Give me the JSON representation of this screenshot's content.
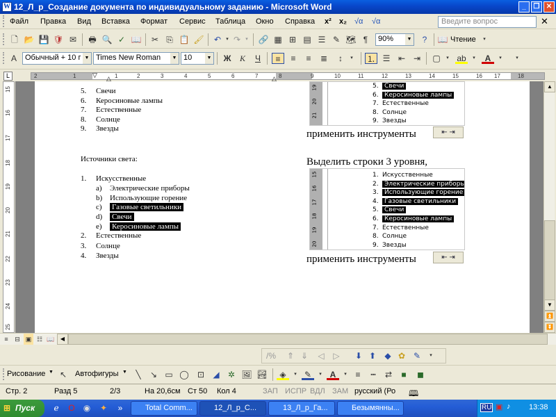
{
  "window": {
    "title": "12_Л_р_Создание документа по индивидуальному заданию - Microsoft Word"
  },
  "menu": {
    "items": [
      "Файл",
      "Правка",
      "Вид",
      "Вставка",
      "Формат",
      "Сервис",
      "Таблица",
      "Окно",
      "Справка"
    ],
    "extra": [
      "x²",
      "x₂",
      "√α",
      "√α"
    ],
    "help_placeholder": "Введите вопрос"
  },
  "toolbar": {
    "zoom": "90%",
    "reading_label": "Чтение"
  },
  "format": {
    "style": "Обычный + 10 г",
    "font": "Times New Roman",
    "size": "10",
    "bold": "Ж",
    "italic": "К",
    "underline": "Ч"
  },
  "ruler": {
    "h_numbers": [
      "2",
      "1",
      "1",
      "2",
      "3",
      "4",
      "5",
      "6",
      "7",
      "8",
      "9",
      "10",
      "11",
      "12",
      "13",
      "14",
      "15",
      "16",
      "17",
      "18"
    ],
    "v_numbers": [
      "15",
      "16",
      "17",
      "18",
      "19",
      "20",
      "21",
      "22",
      "23",
      "24",
      "25"
    ]
  },
  "document": {
    "left_top_list": [
      {
        "num": "5.",
        "text": "Свечи"
      },
      {
        "num": "6.",
        "text": "Керосиновые лампы"
      },
      {
        "num": "7.",
        "text": "Естественные"
      },
      {
        "num": "8.",
        "text": "Солнце"
      },
      {
        "num": "9.",
        "text": "Звезды"
      }
    ],
    "heading": "Источники света:",
    "item1": {
      "num": "1.",
      "text": "Искусственные"
    },
    "subitems": [
      {
        "num": "a)",
        "text": "Электрические приборы",
        "hl": false
      },
      {
        "num": "b)",
        "text": "Использующие горение",
        "hl": false
      },
      {
        "num": "c)",
        "text": "Газовые светильники",
        "hl": true
      },
      {
        "num": "d)",
        "text": "Свечи",
        "hl": true
      },
      {
        "num": "e)",
        "text": "Керосиновые лампы",
        "hl": true
      }
    ],
    "items_after": [
      {
        "num": "2.",
        "text": "Естественные"
      },
      {
        "num": "3.",
        "text": "Солнце"
      },
      {
        "num": "4.",
        "text": "Звезды"
      }
    ],
    "apply_tools_1": "применить инструменты",
    "select_level3": "Выделить строки 3 уровня,",
    "apply_tools_2": "применить инструменты",
    "shot1": [
      {
        "num": "5.",
        "text": "Свечи",
        "hl": true
      },
      {
        "num": "6.",
        "text": "Керосиновые лампы",
        "hl": true
      },
      {
        "num": "7.",
        "text": "Естественные",
        "hl": false
      },
      {
        "num": "8.",
        "text": "Солнце",
        "hl": false
      },
      {
        "num": "9.",
        "text": "Звезды",
        "hl": false
      }
    ],
    "shot1_ruler": [
      "19",
      "20",
      "21"
    ],
    "shot2": [
      {
        "num": "1.",
        "text": "Искусственные",
        "hl": false
      },
      {
        "num": "2.",
        "text": "Электрические приборы",
        "hl": true
      },
      {
        "num": "3.",
        "text": "Использующие горение",
        "hl": true
      },
      {
        "num": "4.",
        "text": "Газовые светильники",
        "hl": true
      },
      {
        "num": "5.",
        "text": "Свечи",
        "hl": true
      },
      {
        "num": "6.",
        "text": "Керосиновые лампы",
        "hl": true
      },
      {
        "num": "7.",
        "text": "Естественные",
        "hl": false
      },
      {
        "num": "8.",
        "text": "Солнце",
        "hl": false
      },
      {
        "num": "9.",
        "text": "Звезды",
        "hl": false
      }
    ],
    "shot2_ruler": [
      "15",
      "16",
      "17",
      "18",
      "19",
      "20"
    ]
  },
  "drawing": {
    "draw_label": "Рисование",
    "autoshapes_label": "Автофигуры"
  },
  "status": {
    "page": "Стр. 2",
    "section": "Разд 5",
    "pages": "2/3",
    "at": "На 20,6см",
    "line": "Ст 50",
    "col": "Кол 4",
    "rec": "ЗАП",
    "trk": "ИСПР",
    "ext": "ВДЛ",
    "ovr": "ЗАМ",
    "lang": "русский (Ро"
  },
  "taskbar": {
    "start": "Пуск",
    "tasks": [
      "Total Comm...",
      "12_Л_р_С...",
      "13_Л_р_Га...",
      "Безымянны..."
    ],
    "lang": "RU",
    "clock": "13:38"
  }
}
